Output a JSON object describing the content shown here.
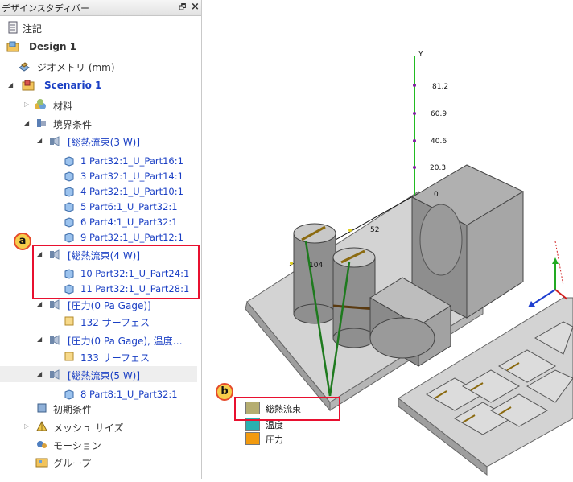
{
  "panel": {
    "title": "デザインスタディバー",
    "pin_glyph": "🗗",
    "close_glyph": "×"
  },
  "tree": {
    "notes": "注記",
    "design": "Design 1",
    "geometry": "ジオメトリ (mm)",
    "scenario": "Scenario 1",
    "materials": "材料",
    "bc": "境界条件",
    "heat3": "[総熱流束(3 W)]",
    "heat3_items": [
      "1 Part32:1_U_Part16:1",
      "3 Part32:1_U_Part14:1",
      "4 Part32:1_U_Part10:1",
      "5 Part6:1_U_Part32:1",
      "6 Part4:1_U_Part32:1",
      "9 Part32:1_U_Part12:1"
    ],
    "heat4": "[総熱流束(4 W)]",
    "heat4_items": [
      "10 Part32:1_U_Part24:1",
      "11 Part32:1_U_Part28:1"
    ],
    "pressure1": "[圧力(0 Pa Gage)]",
    "pressure1_item": "132 サーフェス",
    "pressure2": "[圧力(0 Pa Gage), 温度…",
    "pressure2_item": "133 サーフェス",
    "heat5": "[総熱流束(5 W)]",
    "heat5_item": "8 Part8:1_U_Part32:1",
    "initial": "初期条件",
    "mesh": "メッシュ サイズ",
    "motion": "モーション",
    "groups": "グループ"
  },
  "callouts": {
    "a": "a",
    "b": "b"
  },
  "legend": [
    {
      "label": "総熱流束",
      "color": "#b5ad70"
    },
    {
      "label": "温度",
      "color": "#2ab0b0"
    },
    {
      "label": "圧力",
      "color": "#f29a0f"
    }
  ],
  "axis": {
    "label": "Y",
    "ticks": [
      "81.2",
      "60.9",
      "40.6",
      "20.3",
      "0"
    ],
    "x_tick": "52",
    "z_tick": "104"
  },
  "colors": {
    "callout": "#e8102f",
    "badge": "#f6cd4b",
    "tree_link": "#1a3fc4",
    "axis": "#22bb22"
  }
}
